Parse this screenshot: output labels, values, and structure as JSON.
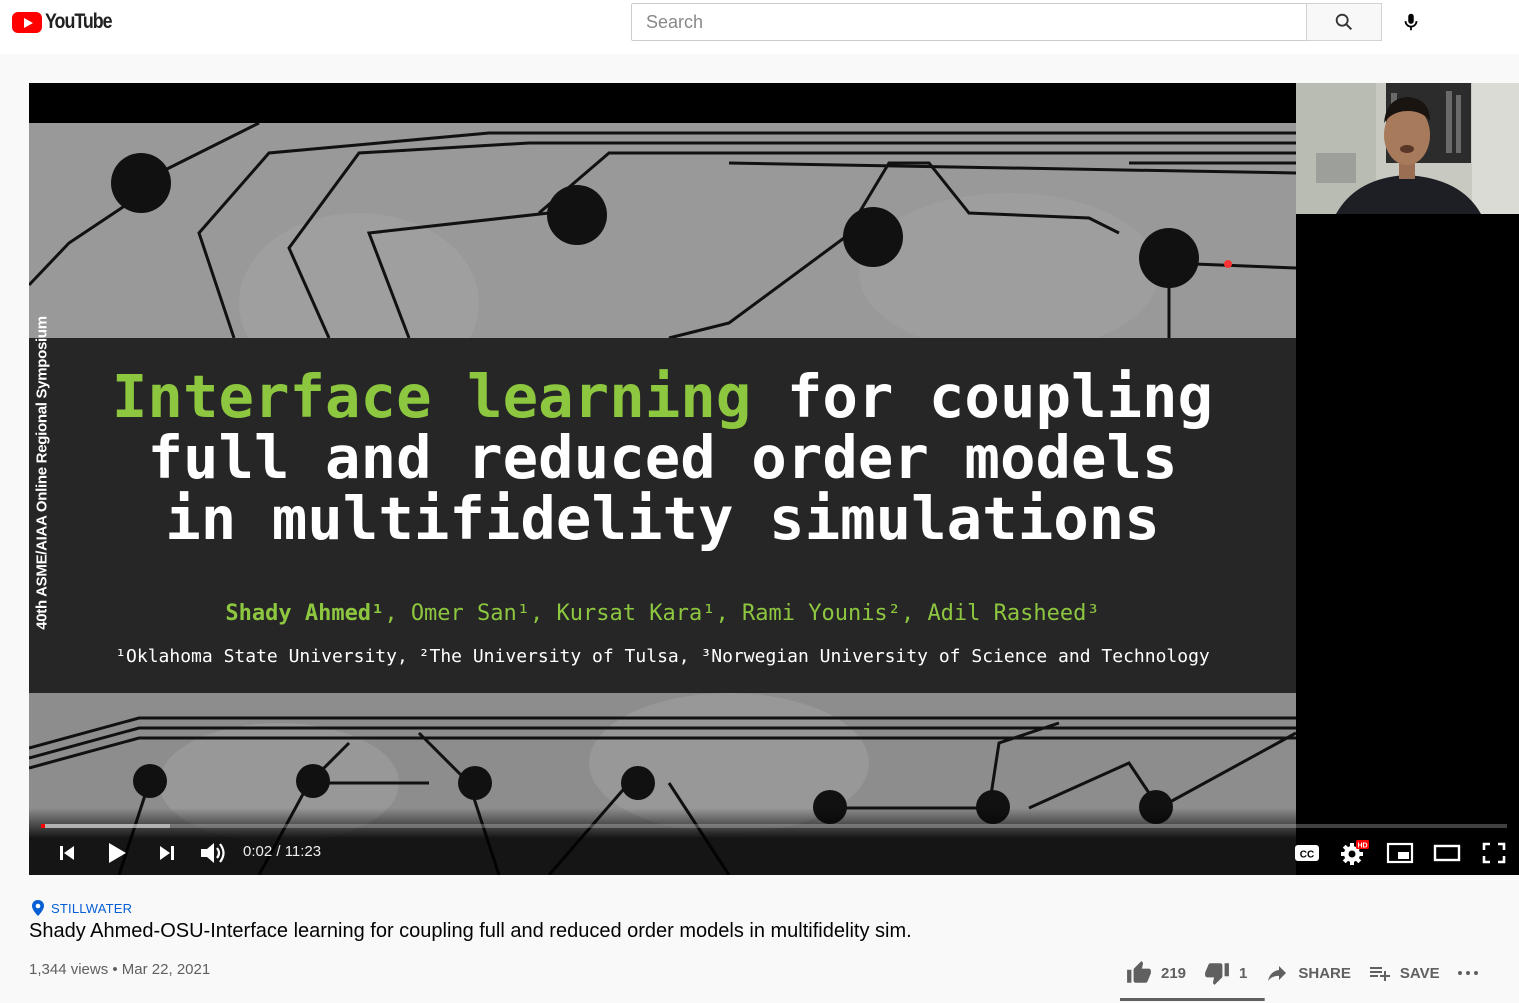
{
  "app": {
    "brand": "YouTube"
  },
  "search": {
    "placeholder": "Search",
    "value": ""
  },
  "icons": {
    "search": "search-icon",
    "mic": "microphone-icon",
    "location": "location-pin-icon",
    "like": "thumbs-up-icon",
    "dislike": "thumbs-down-icon",
    "share": "share-arrow-icon",
    "save": "playlist-add-icon",
    "more": "more-horizontal-icon"
  },
  "slide": {
    "title_highlight": "Interface learning",
    "title_rest_line1": " for coupling",
    "title_line2": "full and reduced order models",
    "title_line3": "in multifidelity simulations",
    "side_label": "40th ASME/AIAA Online Regional Symposium",
    "authors": [
      {
        "name": "Shady Ahmed",
        "sup": "1",
        "bold": true
      },
      {
        "name": "Omer San",
        "sup": "1",
        "bold": false
      },
      {
        "name": "Kursat Kara",
        "sup": "1",
        "bold": false
      },
      {
        "name": "Rami Younis",
        "sup": "2",
        "bold": false
      },
      {
        "name": "Adil Rasheed",
        "sup": "3",
        "bold": false
      }
    ],
    "affiliations": [
      {
        "sup": "1",
        "name": "Oklahoma State University"
      },
      {
        "sup": "2",
        "name": "The University of Tulsa"
      },
      {
        "sup": "3",
        "name": "Norwegian University of Science and Technology"
      }
    ]
  },
  "player": {
    "time_current": "0:02",
    "time_total": "11:23",
    "time_display": "0:02 / 11:23",
    "progress_played_fraction": 0.003,
    "progress_loaded_fraction": 0.088,
    "quality_badge": "HD",
    "captions_label": "CC"
  },
  "video": {
    "location": "STILLWATER",
    "title": "Shady Ahmed-OSU-Interface learning for coupling full and reduced order models in multifidelity sim.",
    "meta": "1,344 views • Mar 22, 2021",
    "likes": "219",
    "dislikes": "1",
    "share_label": "SHARE",
    "save_label": "SAVE",
    "like_fraction": 0.995
  },
  "colors": {
    "brand_red": "#ff0000",
    "slide_green": "#8dc63f",
    "link_blue": "#065fd4"
  }
}
